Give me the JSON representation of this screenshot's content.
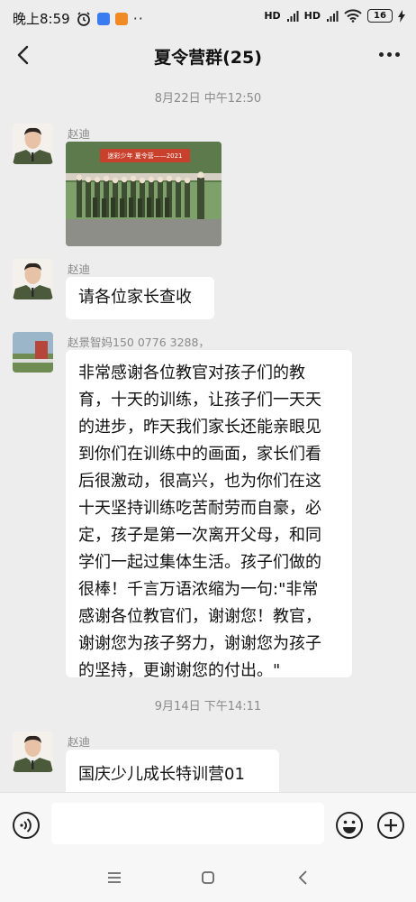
{
  "status_bar": {
    "time": "晚上8:59",
    "signal_1": "HD",
    "signal_2": "HD",
    "battery": "16"
  },
  "header": {
    "title": "夏令营群(25)"
  },
  "messages": [
    {
      "type": "timestamp",
      "text": "8月22日 中午12:50"
    },
    {
      "type": "image",
      "sender": "赵迪",
      "banner_text": "迷彩少年 夏令营——2021"
    },
    {
      "type": "text",
      "sender": "赵迪",
      "text": "请各位家长查收"
    },
    {
      "type": "text",
      "sender": "赵景智妈150 0776 3288，",
      "lines": [
        "非常感谢各位教官对孩子们的教",
        "育，十天的训练，让孩子们一天天",
        "的进步，昨天我们家长还能亲眼见",
        "到你们在训练中的画面，家长们看",
        "后很激动，很高兴，也为你们在这",
        "十天坚持训练吃苦耐劳而自豪，必",
        "定，孩子是第一次离开父母，和同",
        "学们一起过集体生活。孩子们做的",
        "很棒！千言万语浓缩为一句:\"非常",
        "感谢各位教官们，谢谢您！教官，",
        "谢谢您为孩子努力，谢谢您为孩子",
        "的坚持，更谢谢您的付出。\""
      ]
    },
    {
      "type": "timestamp",
      "text": "9月14日 下午14:11"
    },
    {
      "type": "text",
      "sender": "赵迪",
      "text": "国庆少儿成长特训营01"
    }
  ],
  "colors": {
    "background": "#ededed",
    "bubble": "#ffffff",
    "meta_text": "#8a8a8a"
  },
  "icons": {
    "back": "chevron-left-icon",
    "more": "more-dots-icon",
    "voice": "voice-icon",
    "emoji": "emoji-icon",
    "plus": "plus-icon"
  }
}
